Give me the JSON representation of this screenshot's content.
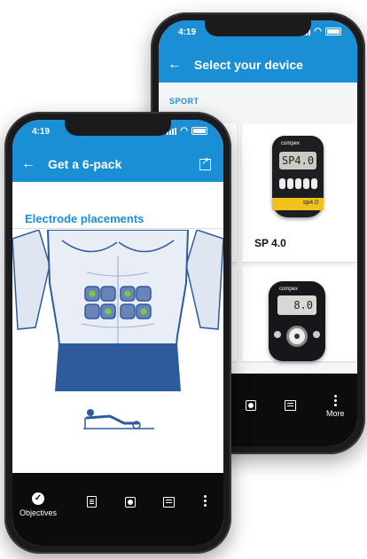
{
  "back_phone": {
    "status": {
      "time": "4:19"
    },
    "appbar": {
      "back_icon": "arrow-left-icon",
      "title": "Select your device"
    },
    "section": "SPORT",
    "devices": [
      {
        "name": "SP 4.0",
        "screen": "SP4.0",
        "stripe": "sp4.0"
      },
      {
        "name": "",
        "screen": "8.0"
      }
    ],
    "brand": "compex",
    "bottom_nav": [
      {
        "icon": "device-icon",
        "label": ""
      },
      {
        "icon": "list-icon",
        "label": ""
      },
      {
        "icon": "more-icon",
        "label": "More"
      }
    ]
  },
  "front_phone": {
    "status": {
      "time": "4:19"
    },
    "appbar": {
      "back_icon": "arrow-left-icon",
      "title": "Get a 6-pack",
      "action_icon": "share-icon"
    },
    "content": {
      "section_title": "Electrode placements"
    },
    "bottom_nav": [
      {
        "icon": "check-circle-icon",
        "label": "Objectives"
      },
      {
        "icon": "document-icon",
        "label": ""
      },
      {
        "icon": "device-icon",
        "label": ""
      },
      {
        "icon": "list-icon",
        "label": ""
      },
      {
        "icon": "more-icon",
        "label": ""
      }
    ]
  },
  "colors": {
    "accent": "#1a8fd6",
    "nav_bg": "#0c0c0d",
    "electrode": "#2e5b9e",
    "active_dot": "#7ac943"
  }
}
